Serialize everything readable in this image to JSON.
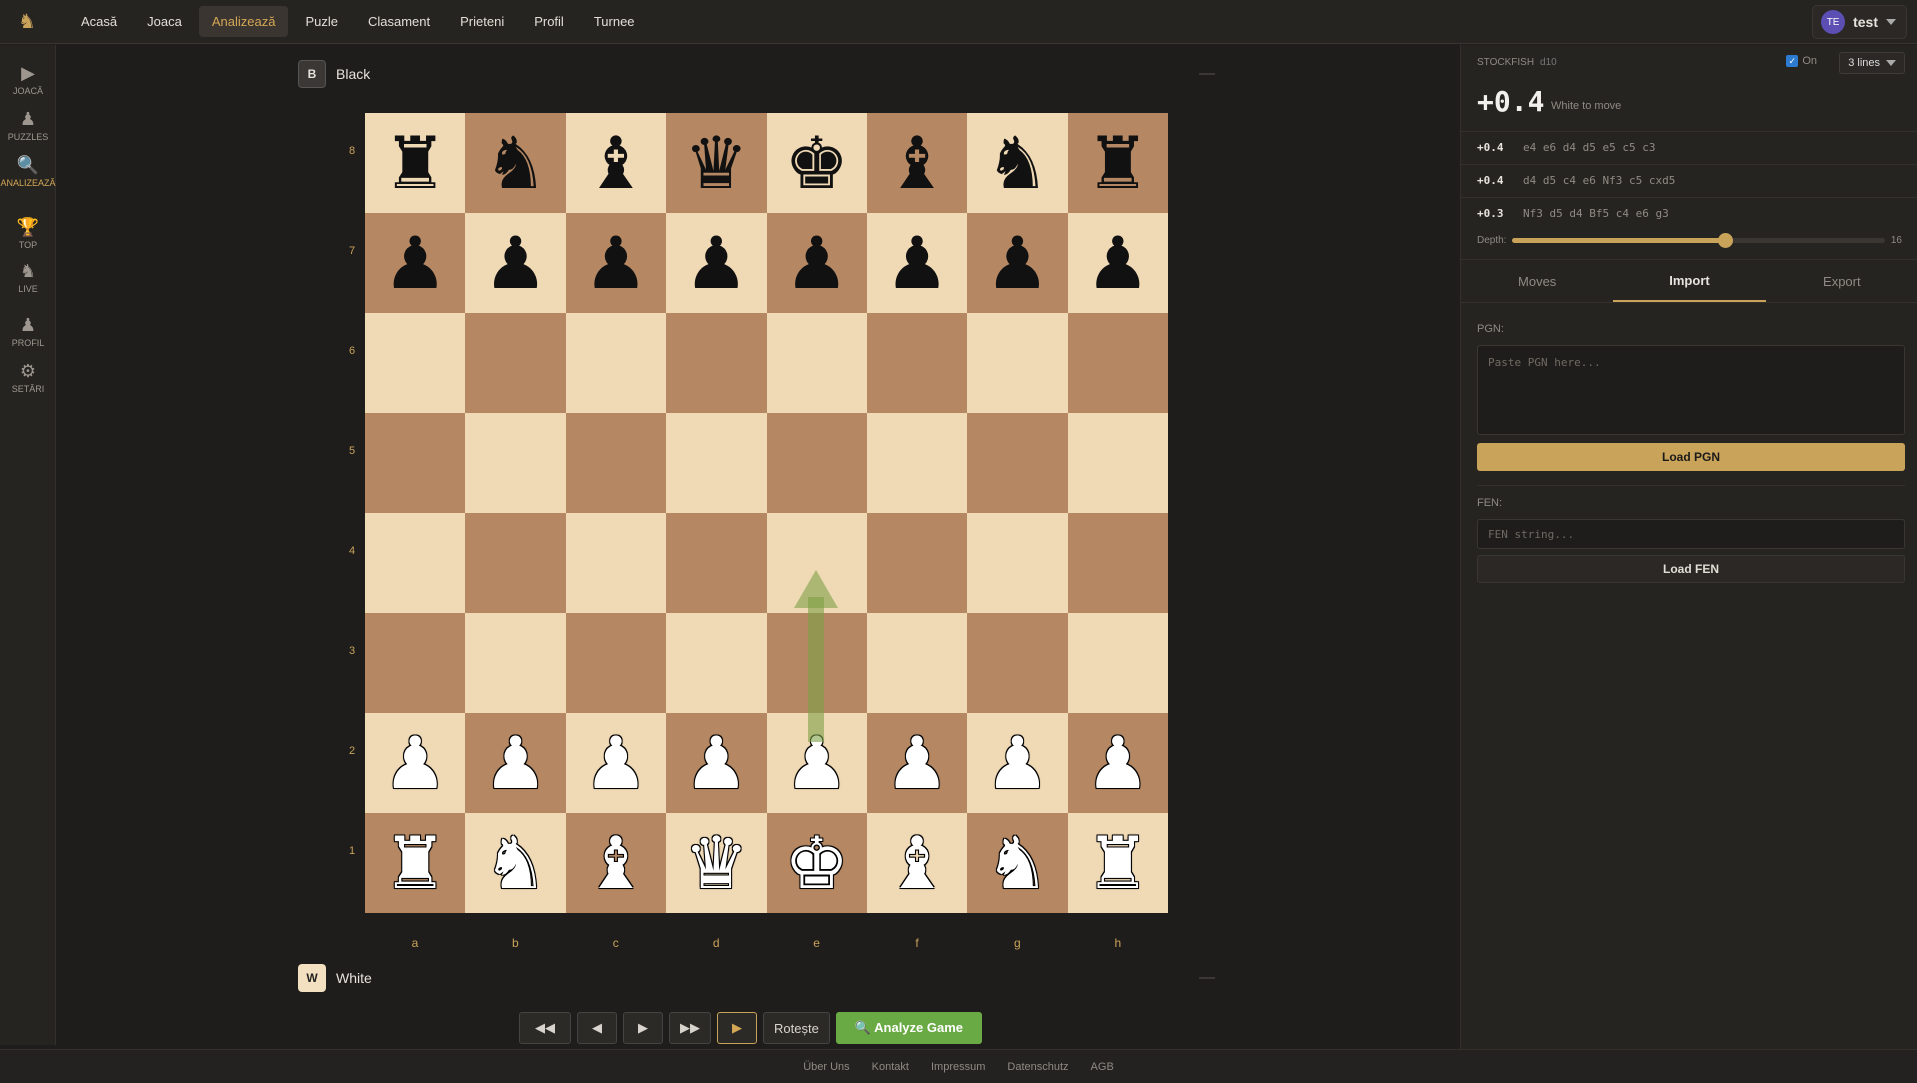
{
  "nav": {
    "items": [
      "Acasă",
      "Joaca",
      "Analizează",
      "Puzle",
      "Clasament",
      "Prieteni",
      "Profil",
      "Turnee"
    ],
    "active_index": 2
  },
  "user": {
    "initials": "TE",
    "name": "test"
  },
  "sidebar": {
    "items": [
      {
        "label": "JOACĂ",
        "icon": "play-icon"
      },
      {
        "label": "PUZZLES",
        "icon": "pawn-icon"
      },
      {
        "label": "ANALIZEAZĂ",
        "icon": "magnifier-icon"
      },
      {
        "label": "TOP",
        "icon": "trophy-icon"
      },
      {
        "label": "LIVE",
        "icon": "live-icon"
      },
      {
        "label": "PROFIL",
        "icon": "profile-icon"
      },
      {
        "label": "SETĂRI",
        "icon": "gear-icon"
      }
    ],
    "active_index": 2
  },
  "players": {
    "top": {
      "badge": "B",
      "name": "Black"
    },
    "bottom": {
      "badge": "W",
      "name": "White"
    }
  },
  "board": {
    "ranks": [
      "8",
      "7",
      "6",
      "5",
      "4",
      "3",
      "2",
      "1"
    ],
    "files": [
      "a",
      "b",
      "c",
      "d",
      "e",
      "f",
      "g",
      "h"
    ],
    "rows": [
      [
        "r",
        "n",
        "b",
        "q",
        "k",
        "b",
        "n",
        "r"
      ],
      [
        "p",
        "p",
        "p",
        "p",
        "p",
        "p",
        "p",
        "p"
      ],
      [
        "",
        "",
        "",
        "",
        "",
        "",
        "",
        ""
      ],
      [
        "",
        "",
        "",
        "",
        "",
        "",
        "",
        ""
      ],
      [
        "",
        "",
        "",
        "",
        "",
        "",
        "",
        ""
      ],
      [
        "",
        "",
        "",
        "",
        "",
        "",
        "",
        ""
      ],
      [
        "P",
        "P",
        "P",
        "P",
        "P",
        "P",
        "P",
        "P"
      ],
      [
        "R",
        "N",
        "B",
        "Q",
        "K",
        "B",
        "N",
        "R"
      ]
    ],
    "arrow": {
      "from": "e2",
      "to": "e4",
      "color": "#7da046"
    },
    "light_color": "#f0d9b5",
    "dark_color": "#b58863"
  },
  "controls": {
    "first": "◀◀",
    "prev": "◀",
    "next": "▶",
    "last": "▶▶",
    "play": "▶",
    "rotate": "Rotește",
    "analyze": "🔍 Analyze Game"
  },
  "footer": {
    "links": [
      "Über Uns",
      "Kontakt",
      "Impressum",
      "Datenschutz",
      "AGB"
    ]
  },
  "engine": {
    "name": "STOCKFISH",
    "depth_tag": "d10",
    "on_label": "On",
    "lines_value": "3 lines",
    "eval": "+0.4",
    "eval_sub": "White to move",
    "lines": [
      {
        "score": "+0.4",
        "moves": "e4 e6 d4 d5 e5 c5 c3"
      },
      {
        "score": "+0.4",
        "moves": "d4 d5 c4 e6 Nf3 c5 cxd5"
      },
      {
        "score": "+0.3",
        "moves": "Nf3 d5 d4 Bf5 c4 e6 g3"
      }
    ],
    "depth_label": "Depth:",
    "depth_value": "16",
    "depth_fraction": 0.57
  },
  "tabs": {
    "items": [
      "Moves",
      "Import",
      "Export"
    ],
    "active_index": 1
  },
  "import": {
    "pgn_label": "PGN:",
    "pgn_placeholder": "Paste PGN here...",
    "load_pgn": "Load PGN",
    "fen_label": "FEN:",
    "fen_placeholder": "FEN string...",
    "load_fen": "Load FEN"
  },
  "colors": {
    "accent": "#c9a35a",
    "green": "#6aaa44",
    "bg": "#1f1d1b"
  }
}
